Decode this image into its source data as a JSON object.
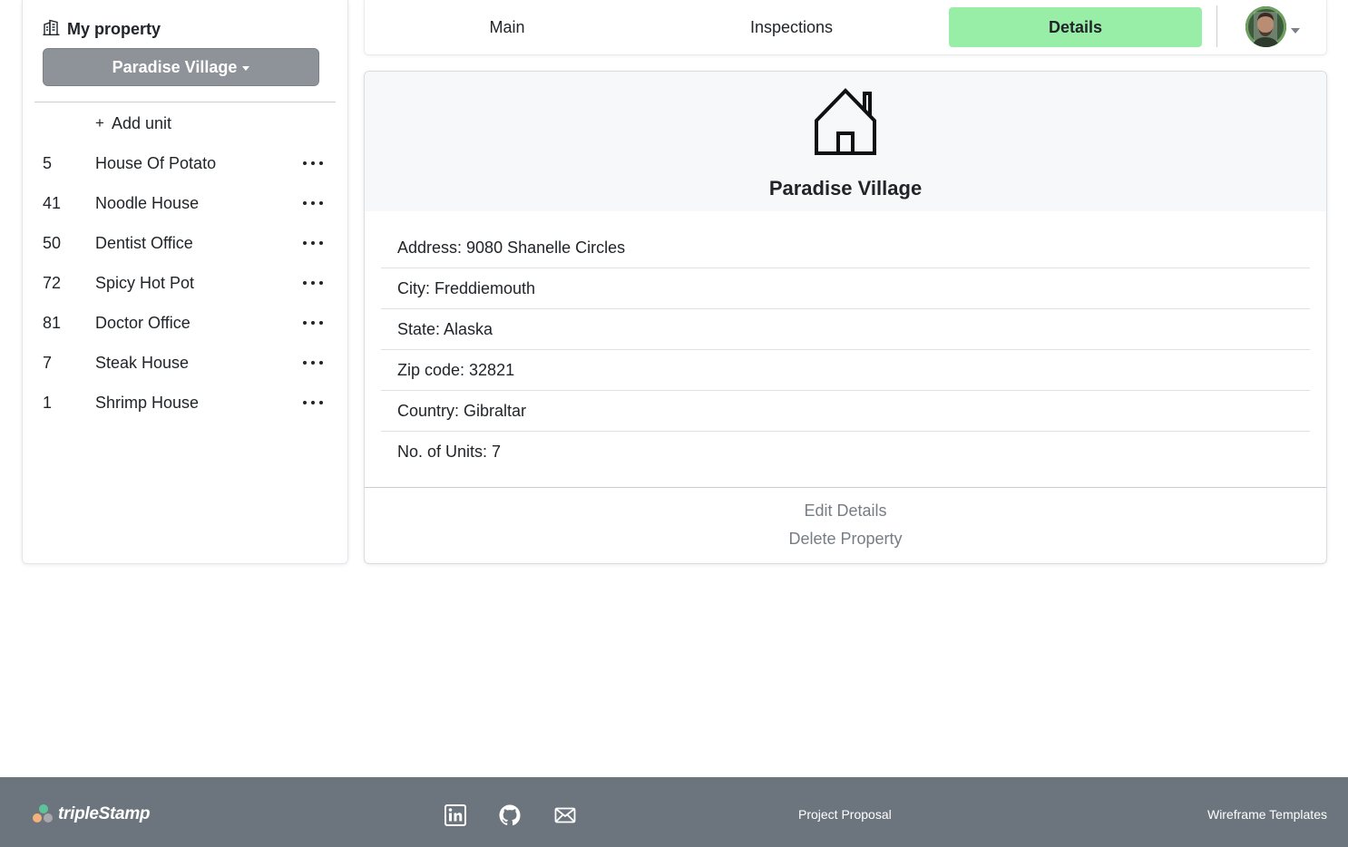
{
  "sidebar": {
    "title": "My property",
    "title_icon": "building-icon",
    "property_selector": "Paradise Village",
    "add_unit_label": "Add unit",
    "add_unit_icon": "+",
    "units": [
      {
        "number": "5",
        "name": "House Of Potato"
      },
      {
        "number": "41",
        "name": "Noodle House"
      },
      {
        "number": "50",
        "name": "Dentist Office"
      },
      {
        "number": "72",
        "name": "Spicy Hot Pot"
      },
      {
        "number": "81",
        "name": "Doctor Office"
      },
      {
        "number": "7",
        "name": "Steak House"
      },
      {
        "number": "1",
        "name": "Shrimp House"
      }
    ]
  },
  "nav": {
    "tabs": [
      "Main",
      "Inspections",
      "Details"
    ],
    "active_tab": "Details",
    "active_color": "#98eda7"
  },
  "details": {
    "icon": "house-icon",
    "property_name": "Paradise Village",
    "fields": [
      "Address: 9080 Shanelle Circles",
      "City: Freddiemouth",
      "State: Alaska",
      "Zip code: 32821",
      "Country: Gibraltar",
      "No. of Units: 7"
    ],
    "edit_label": "Edit Details",
    "delete_label": "Delete Property"
  },
  "footer": {
    "brand": "tripleStamp",
    "social_icons": [
      "linkedin-icon",
      "github-icon",
      "mail-icon"
    ],
    "links": [
      "Project Proposal",
      "Wireframe Templates"
    ],
    "background": "#6c757d"
  }
}
